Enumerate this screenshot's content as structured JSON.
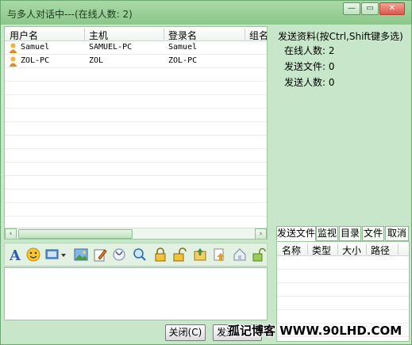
{
  "window": {
    "title": "与多人对话中---(在线人数: 2)",
    "minimize_glyph": "—",
    "maximize_glyph": "▭",
    "close_glyph": "✕"
  },
  "user_list": {
    "columns": [
      "用户名",
      "主机",
      "登录名",
      "组名"
    ],
    "rows": [
      {
        "username": "Samuel",
        "host": "SAMUEL-PC",
        "login": "Samuel",
        "icon": "user-icon"
      },
      {
        "username": "ZOL-PC",
        "host": "ZOL",
        "login": "ZOL-PC",
        "icon": "user-icon"
      }
    ],
    "scroll_left": "‹",
    "scroll_right": "›"
  },
  "send_info": {
    "header": "发送资料(按Ctrl,Shift键多选)",
    "online_count": "在线人数: 2",
    "send_files": "发送文件: 0",
    "send_people": "发送人数: 0"
  },
  "toolbar": {
    "icons": [
      "font-icon",
      "emoji-icon",
      "screen-dropdown-icon",
      "image-icon",
      "edit-icon",
      "stethoscope-icon",
      "magnifier-icon",
      "lock-icon",
      "unlock-icon",
      "upload-icon",
      "file-upload-icon",
      "home-icon",
      "open-lock-icon"
    ]
  },
  "tabs": [
    "发送文件",
    "监视",
    "目录",
    "文件",
    "取消"
  ],
  "file_list": {
    "columns": [
      "名称",
      "类型",
      "大小",
      "路径"
    ]
  },
  "buttons": {
    "close": "关闭(C)",
    "send": "发送"
  },
  "watermark": "孤记博客 WWW.90LHD.COM",
  "colors": {
    "window_bg": "#c8e6c9",
    "titlebar": "#8cc68a"
  }
}
